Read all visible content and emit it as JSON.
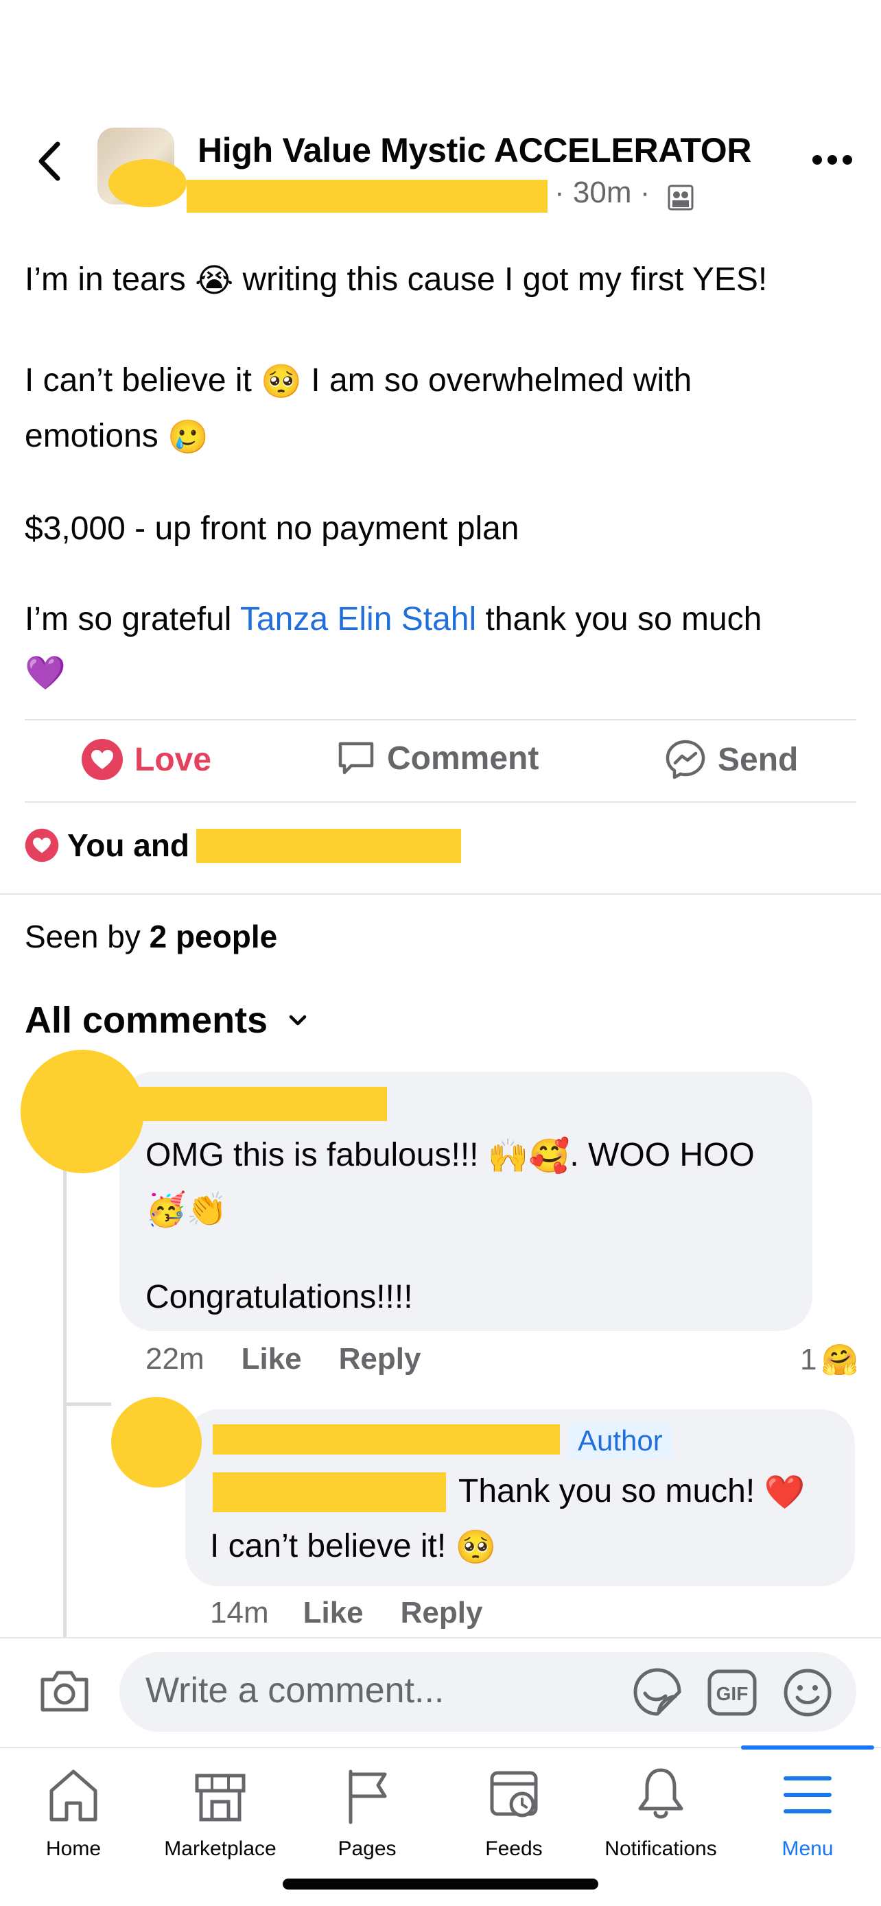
{
  "header": {
    "group_name": "High Value Mystic ACCELERATOR",
    "time": "· 30m ·",
    "group_icon": "group-members-icon"
  },
  "post": {
    "line1_a": "I’m in tears",
    "line1_b": "writing this cause I got my first YES!",
    "line2_a": "I can’t believe it",
    "line2_b": "I am so overwhelmed with",
    "line3": "emotions",
    "line4": "$3,000 - up front no payment plan",
    "line5_a": "I’m so grateful",
    "mention": "Tanza Elin Stahl",
    "line5_b": "thank you so much",
    "emojis": {
      "crying": "😭",
      "pleading": "🥺",
      "sad_tear": "🥲",
      "purple_heart": "💜"
    }
  },
  "actions": {
    "love": "Love",
    "comment": "Comment",
    "send": "Send"
  },
  "reactions": {
    "text": "You and"
  },
  "seen": {
    "prefix": "Seen by",
    "count": "2 people"
  },
  "comments_header": {
    "label": "All comments"
  },
  "comments": [
    {
      "text_a": "OMG this is fabulous!!!",
      "emoji_a": "🙌🥰",
      "text_b": ". WOO HOO",
      "emoji_b": "🥳👏",
      "text_c": "Congratulations!!!!",
      "time": "22m",
      "like": "Like",
      "reply": "Reply",
      "reaction_count": "1",
      "reaction_emoji": "🤗"
    },
    {
      "badge": "Author",
      "text_a": "Thank you so much!",
      "emoji_a": "❤️",
      "text_b": "I can’t believe it!",
      "emoji_b": "🥺",
      "time": "14m",
      "like": "Like",
      "reply": "Reply"
    }
  ],
  "composer": {
    "placeholder": "Write a comment..."
  },
  "tabs": [
    {
      "label": "Home",
      "icon": "home-icon"
    },
    {
      "label": "Marketplace",
      "icon": "marketplace-icon"
    },
    {
      "label": "Pages",
      "icon": "flag-icon"
    },
    {
      "label": "Feeds",
      "icon": "feeds-icon"
    },
    {
      "label": "Notifications",
      "icon": "bell-icon"
    },
    {
      "label": "Menu",
      "icon": "menu-icon",
      "active": true
    }
  ],
  "colors": {
    "accent": "#1877f2",
    "love": "#e5405e",
    "mention": "#216fdb",
    "redaction": "#fdd02f"
  }
}
